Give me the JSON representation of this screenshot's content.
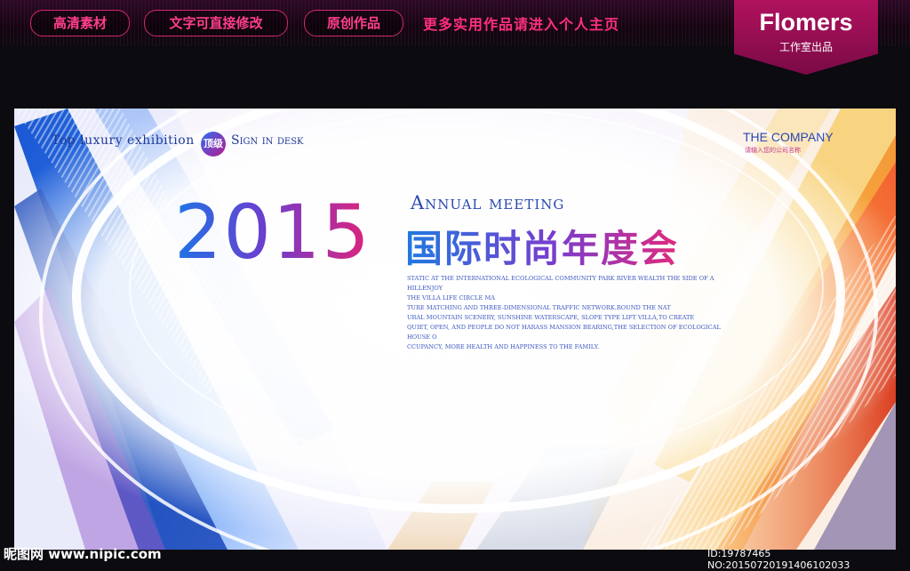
{
  "header": {
    "pills": [
      "高清素材",
      "文字可直接修改",
      "原创作品"
    ],
    "tagline": "更多实用作品请进入个人主页",
    "brand_name": "Flomers",
    "brand_sub": "工作室出品"
  },
  "poster": {
    "top_line_left": "Top luxury exhibition",
    "badge": "顶级",
    "top_line_right": "Sign in desk",
    "company": "THE COMPANY",
    "company_sub": "请输入您的公司名称",
    "year": "2015",
    "annual": "Annual meeting",
    "cn_title": "国际时尚年度会",
    "paragraph": [
      "STATIC AT THE INTERNATIONAL ECOLOGICAL COMMUNITY PARK RIVER WEALTH THE SIDE OF A HILLENJOY",
      "THE VILLA LIFE CIRCLE MA",
      "TURE MATCHING AND THREE-DIMENSIONAL TRAFFIC NETWORK.ROUND THE NAT",
      "URAL MOUNTAIN SCENERY, SUNSHINE WATERSCAPE, SLOPE TYPE LIFT VILLA,TO CREATE",
      "QUIET, OPEN, AND PEOPLE DO NOT HARASS MANSION BEARING,THE SELECTION OF ECOLOGICAL HOUSE O",
      "CCUPANCY, MORE HEALTH AND HAPPINESS TO THE FAMILY."
    ]
  },
  "watermark": {
    "left": "昵图网 www.nipic.com",
    "right": "ID:19787465 NO:20150720191406102033"
  },
  "colors": {
    "accent_pink": "#ff2f7f",
    "accent_blue": "#1e74e6",
    "accent_orange": "#f06a1a"
  }
}
